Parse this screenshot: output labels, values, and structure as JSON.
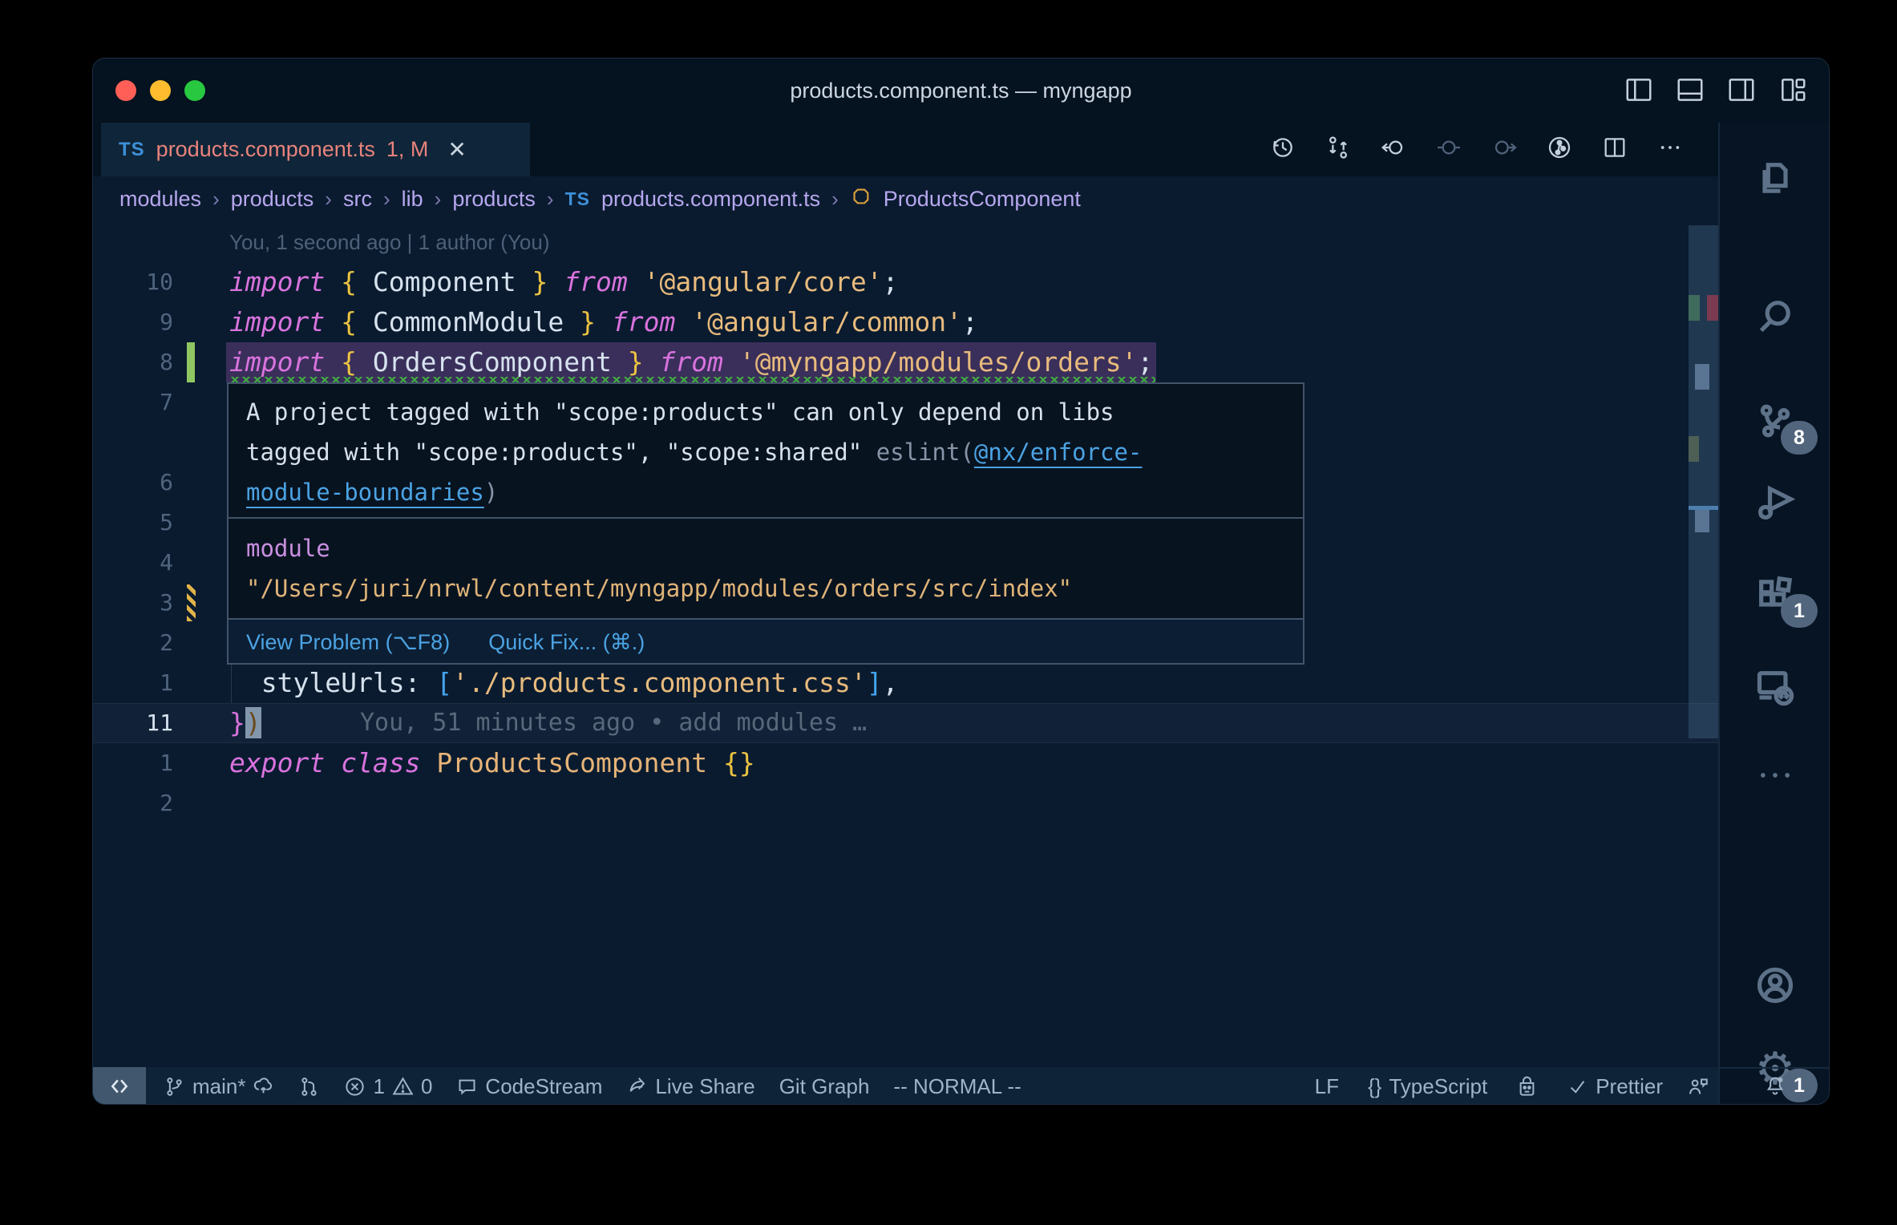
{
  "window": {
    "title": "products.component.ts — myngapp"
  },
  "tab": {
    "language": "TS",
    "filename": "products.component.ts",
    "badge": "1, M",
    "close": "✕"
  },
  "breadcrumbs": {
    "separator": "›",
    "items": [
      "modules",
      "products",
      "src",
      "lib",
      "products",
      "products.component.ts",
      "ProductsComponent"
    ],
    "file_language": "TS"
  },
  "editor": {
    "blame_header": "You, 1 second ago | 1 author (You)",
    "current_line_blame": "You, 51 minutes ago • add modules …",
    "lines": [
      {
        "num": "10",
        "tokens": [
          {
            "t": "import"
          },
          {
            "t": " "
          },
          {
            "t": "{"
          },
          {
            "t": " Component "
          },
          {
            "t": "}"
          },
          {
            "t": " "
          },
          {
            "t": "from"
          },
          {
            "t": " "
          },
          {
            "t": "'@angular/core'"
          },
          {
            "t": ";"
          }
        ]
      },
      {
        "num": "9",
        "tokens": [
          {
            "t": "import"
          },
          {
            "t": " "
          },
          {
            "t": "{"
          },
          {
            "t": " CommonModule "
          },
          {
            "t": "}"
          },
          {
            "t": " "
          },
          {
            "t": "from"
          },
          {
            "t": " "
          },
          {
            "t": "'@angular/common'"
          },
          {
            "t": ";"
          }
        ]
      },
      {
        "num": "8",
        "tokens": [
          {
            "t": "import"
          },
          {
            "t": " "
          },
          {
            "t": "{"
          },
          {
            "t": " OrdersComponent "
          },
          {
            "t": "}"
          },
          {
            "t": " "
          },
          {
            "t": "from"
          },
          {
            "t": " "
          },
          {
            "t": "'@myngapp/modules/orders'"
          },
          {
            "t": ";"
          }
        ]
      },
      {
        "num": "7"
      },
      {
        "num": ""
      },
      {
        "num": "6"
      },
      {
        "num": "5"
      },
      {
        "num": "4"
      },
      {
        "num": "3"
      },
      {
        "num": "2"
      },
      {
        "num": "1",
        "tokens": [
          {
            "t": "  "
          },
          {
            "t": "styleUrls"
          },
          {
            "t": ": "
          },
          {
            "t": "["
          },
          {
            "t": "'./products.component.css'"
          },
          {
            "t": "]"
          },
          {
            "t": ","
          }
        ]
      },
      {
        "num": "11",
        "tokens": [
          {
            "t": "}"
          },
          {
            "t": ")"
          }
        ]
      },
      {
        "num": "1",
        "tokens": [
          {
            "t": "export"
          },
          {
            "t": " "
          },
          {
            "t": "class"
          },
          {
            "t": " "
          },
          {
            "t": "ProductsComponent"
          },
          {
            "t": " "
          },
          {
            "t": "{}"
          }
        ]
      },
      {
        "num": "2"
      }
    ]
  },
  "hover": {
    "line1": "A project tagged with \"scope:products\" can only depend on libs",
    "line2_text": "tagged with \"scope:products\", \"scope:shared\" ",
    "line2_source": "eslint(",
    "line2_link": "@nx/enforce-",
    "line3_link": "module-boundaries",
    "line3_source": ")",
    "module_keyword": "module",
    "module_path": "\"/Users/juri/nrwl/content/myngapp/modules/orders/src/index\"",
    "view_problem": "View Problem (⌥F8)",
    "quick_fix": "Quick Fix... (⌘.)"
  },
  "statusbar": {
    "branch": "main*",
    "errors": "1",
    "warnings": "0",
    "codestream": "CodeStream",
    "live_share": "Live Share",
    "git_graph": "Git Graph",
    "vim_mode": "-- NORMAL --",
    "eol": "LF",
    "language_icon": "{}",
    "language": "TypeScript",
    "formatter": "Prettier"
  },
  "activity_bar": {
    "items": [
      {
        "name": "explorer"
      },
      {
        "name": "search"
      },
      {
        "name": "source-control",
        "badge": "8"
      },
      {
        "name": "run-and-debug"
      },
      {
        "name": "extensions",
        "badge": "1"
      },
      {
        "name": "remote-explorer"
      },
      {
        "name": "more-views"
      },
      {
        "name": "accounts"
      },
      {
        "name": "settings",
        "badge": "1"
      },
      {
        "name": "notifications"
      }
    ]
  },
  "colors": {
    "selection": "#3a2f5a",
    "squiggle": "#3fae3f",
    "added_gutter": "#8fc662",
    "modified_gutter": "#e2b348",
    "link": "#4ba3e3",
    "tab_modified": "#e8837c",
    "error_mark": "#7a3b50"
  }
}
